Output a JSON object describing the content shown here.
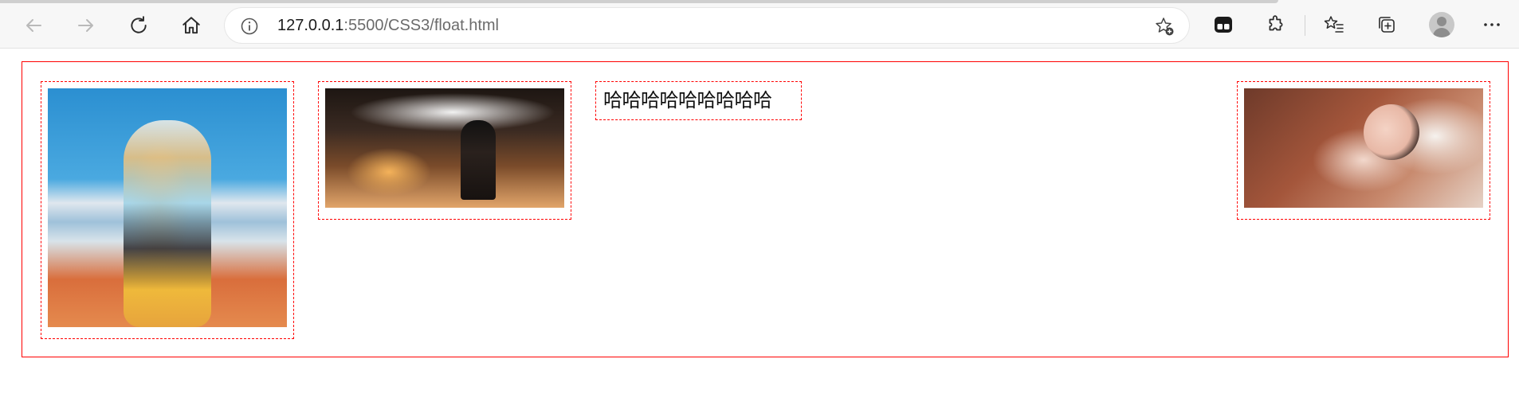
{
  "browser": {
    "url_host": "127.0.0.1",
    "url_rest": ":5500/CSS3/float.html",
    "icons": {
      "back": "arrow-left-icon",
      "forward": "arrow-right-icon",
      "refresh": "refresh-icon",
      "home": "home-icon",
      "site_info": "info-icon",
      "add_favorite": "star-plus-icon",
      "extension_app": "app-extension-icon",
      "extensions": "puzzle-icon",
      "favorites": "favorites-icon",
      "collections": "collections-icon",
      "profile": "profile-avatar-icon",
      "menu": "more-icon"
    }
  },
  "page": {
    "container_border_color": "#ff0000",
    "box_border_color": "#ff0000",
    "text_box": "哈哈哈哈哈哈哈哈哈"
  }
}
